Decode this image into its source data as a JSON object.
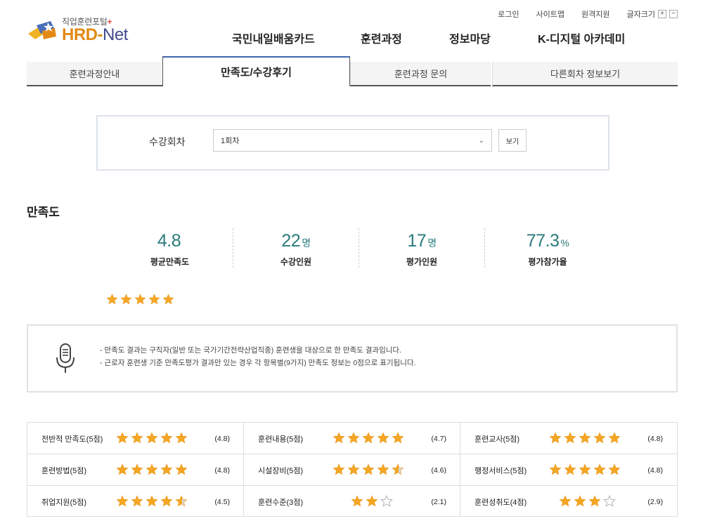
{
  "header": {
    "logo_sub": "직업훈련포털",
    "logo_plus": "+",
    "logo_hrd": "HRD-",
    "logo_net": "Net",
    "util": {
      "login": "로그인",
      "sitemap": "사이트맵",
      "remote": "원격지원",
      "font_size": "글자크기",
      "font_plus": "+",
      "font_minus": "−"
    },
    "nav": [
      "국민내일배움카드",
      "훈련과정",
      "정보마당",
      "K-디지털 아카데미"
    ]
  },
  "tabs": [
    "훈련과정안내",
    "만족도/수강후기",
    "훈련과정 문의",
    "다른회차 정보보기"
  ],
  "session": {
    "label": "수강회차",
    "selected": "1회차",
    "view_button": "보기"
  },
  "satisfaction": {
    "title": "만족도",
    "stats": [
      {
        "value": "4.8",
        "unit": "",
        "label": "평균만족도"
      },
      {
        "value": "22",
        "unit": "명",
        "label": "수강인원"
      },
      {
        "value": "17",
        "unit": "명",
        "label": "평가인원"
      },
      {
        "value": "77.3",
        "unit": "%",
        "label": "평가참가율"
      }
    ],
    "overall_stars": 5
  },
  "notice": {
    "lines": [
      "- 만족도 결과는 구직자(일반 또는 국가기간전략산업직종) 훈련생을 대상으로 한 만족도 결과입니다.",
      "- 근로자 훈련생 기준 만족도평가 결과만 있는 경우 각 항목별(9가지) 만족도 정보는 0점으로 표기됩니다."
    ]
  },
  "ratings": [
    {
      "label": "전반적 만족도(5점)",
      "max": 5,
      "stars": 5,
      "score": "(4.8)"
    },
    {
      "label": "훈련내용(5점)",
      "max": 5,
      "stars": 5,
      "score": "(4.7)"
    },
    {
      "label": "훈련교사(5점)",
      "max": 5,
      "stars": 5,
      "score": "(4.8)"
    },
    {
      "label": "훈련방법(5점)",
      "max": 5,
      "stars": 5,
      "score": "(4.8)"
    },
    {
      "label": "시설장비(5점)",
      "max": 5,
      "stars": 4.5,
      "score": "(4.6)"
    },
    {
      "label": "행정서비스(5점)",
      "max": 5,
      "stars": 5,
      "score": "(4.8)"
    },
    {
      "label": "취업지원(5점)",
      "max": 5,
      "stars": 4.5,
      "score": "(4.5)"
    },
    {
      "label": "훈련수준(3점)",
      "max": 3,
      "stars": 2,
      "score": "(2.1)"
    },
    {
      "label": "훈련성취도(4점)",
      "max": 4,
      "stars": 3,
      "score": "(2.9)"
    }
  ],
  "colors": {
    "accent_teal": "#2a7b7c",
    "star_gold": "#f5a623",
    "tab_active_top": "#3e64a9",
    "logo_orange": "#e38a16",
    "logo_navy": "#404a8c"
  }
}
